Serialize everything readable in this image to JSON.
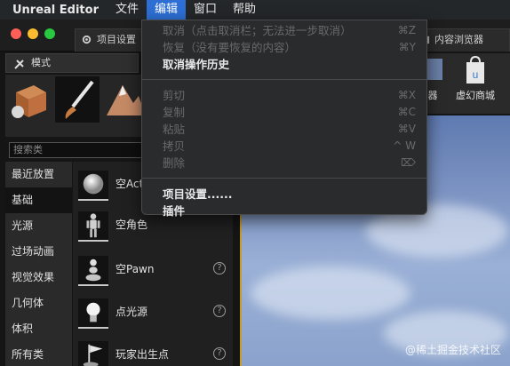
{
  "menubar": {
    "app": "Unreal Editor",
    "items": [
      "文件",
      "编辑",
      "窗口",
      "帮助"
    ],
    "active_index": 1
  },
  "tabs": {
    "project_settings": "项目设置",
    "content_browser": "内容浏览器"
  },
  "modes_panel": {
    "title": "模式",
    "search_placeholder": "搜索类",
    "categories": [
      "最近放置",
      "基础",
      "光源",
      "过场动画",
      "视觉效果",
      "几何体",
      "体积",
      "所有类"
    ],
    "selected_category": 1,
    "items": [
      {
        "name": "空Actor",
        "help": false,
        "icon": "sphere-icon"
      },
      {
        "name": "空角色",
        "help": false,
        "icon": "mannequin-icon"
      },
      {
        "name": "空Pawn",
        "help": true,
        "icon": "pawn-icon"
      },
      {
        "name": "点光源",
        "help": true,
        "icon": "bulb-icon"
      },
      {
        "name": "玩家出生点",
        "help": true,
        "icon": "flag-icon"
      }
    ]
  },
  "toolbar": {
    "marketplace": "虚幻商城",
    "partial_label": "器"
  },
  "edit_menu": {
    "items": [
      {
        "label": "取消（点击取消栏；无法进一步取消）",
        "shortcut": "⌘Z",
        "disabled": true
      },
      {
        "label": "恢复（没有要恢复的内容）",
        "shortcut": "⌘Y",
        "disabled": true
      },
      {
        "label": "取消操作历史",
        "shortcut": "",
        "disabled": false
      }
    ],
    "clipboard": [
      {
        "label": "剪切",
        "shortcut": "⌘X",
        "disabled": true
      },
      {
        "label": "复制",
        "shortcut": "⌘C",
        "disabled": true
      },
      {
        "label": "粘贴",
        "shortcut": "⌘V",
        "disabled": true
      },
      {
        "label": "拷贝",
        "shortcut": "^ W",
        "disabled": true
      },
      {
        "label": "删除",
        "shortcut": "⌦",
        "disabled": true
      }
    ],
    "settings": [
      {
        "label": "项目设置......",
        "shortcut": "",
        "disabled": false
      },
      {
        "label": "插件",
        "shortcut": "",
        "disabled": false
      }
    ]
  },
  "watermark": "@稀土掘金技术社区",
  "colors": {
    "menu_highlight": "#2d6fd4",
    "close": "#ff5f57",
    "minimize": "#febc2e",
    "zoom": "#28c840",
    "viewport_border": "#c89b2b"
  }
}
